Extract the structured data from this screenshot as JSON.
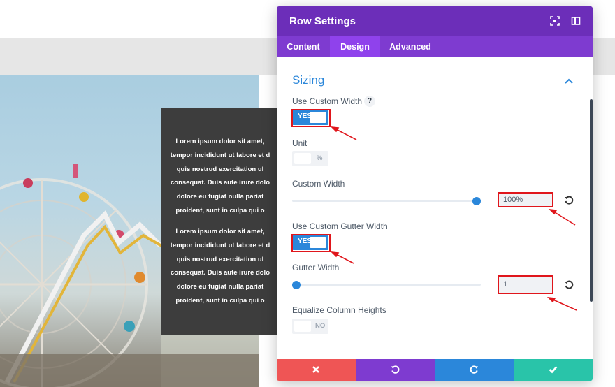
{
  "page": {
    "paragraph_1": [
      "Lorem ipsum dolor sit amet,",
      "tempor incididunt ut labore et d",
      "quis nostrud exercitation ul",
      "consequat. Duis aute irure dolo",
      "dolore eu fugiat nulla pariat",
      "proident, sunt in culpa qui o"
    ],
    "paragraph_2": [
      "Lorem ipsum dolor sit amet,",
      "tempor incididunt ut labore et d",
      "quis nostrud exercitation ul",
      "consequat. Duis aute irure dolo",
      "dolore eu fugiat nulla pariat",
      "proident, sunt in culpa qui o"
    ]
  },
  "panel": {
    "title": "Row Settings",
    "header_icons": [
      "focus-icon",
      "sidebar-icon"
    ],
    "tabs": [
      {
        "label": "Content",
        "active": false
      },
      {
        "label": "Design",
        "active": true
      },
      {
        "label": "Advanced",
        "active": false
      }
    ],
    "section": "Sizing",
    "fields": {
      "use_custom_width": {
        "label": "Use Custom Width",
        "help": "?",
        "toggle": "YES"
      },
      "unit": {
        "label": "Unit",
        "toggle": "%"
      },
      "custom_width": {
        "label": "Custom Width",
        "value": "100%",
        "slider_level": 1.0
      },
      "use_custom_gutter_width": {
        "label": "Use Custom Gutter Width",
        "toggle": "YES"
      },
      "gutter_width": {
        "label": "Gutter Width",
        "value": "1",
        "slider_level": 0.0
      },
      "equalize_column_heights": {
        "label": "Equalize Column Heights",
        "toggle": "NO"
      }
    },
    "footer_buttons": [
      "close-icon",
      "undo-icon",
      "redo-icon",
      "check-icon"
    ]
  },
  "colors": {
    "header": "#6c2eb9",
    "tabs": "#7e3bd0",
    "accent": "#2b87da",
    "highlight": "#e0161c",
    "btn_close": "#ef5555",
    "btn_undo": "#7e3bd0",
    "btn_redo": "#2b87da",
    "btn_save": "#29c4a9"
  }
}
